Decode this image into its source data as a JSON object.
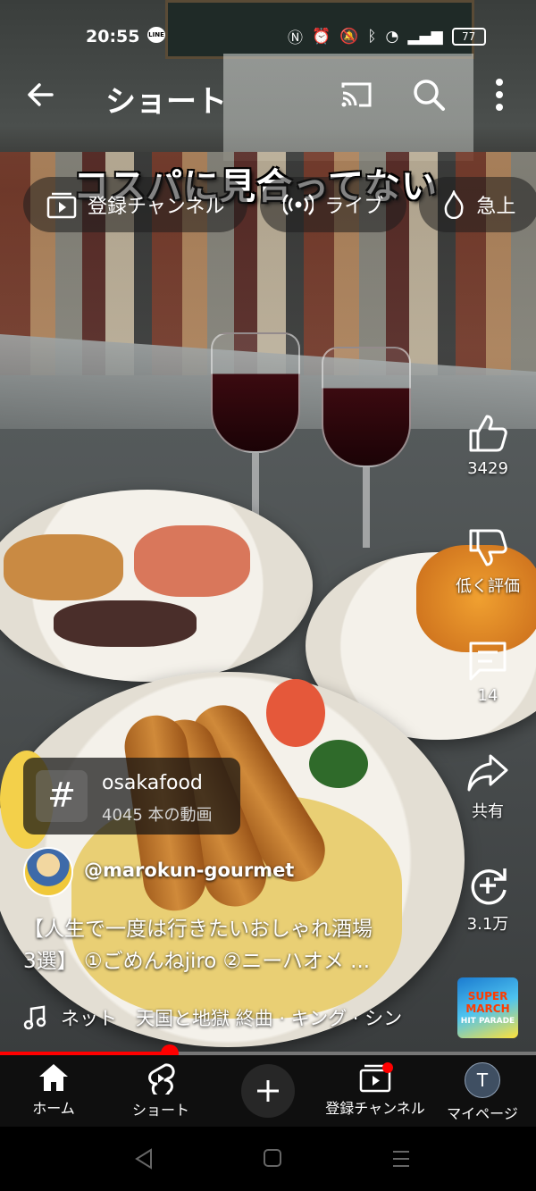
{
  "status_bar": {
    "time": "20:55",
    "line_badge": "LINE",
    "battery": "77"
  },
  "header": {
    "title": "ショート"
  },
  "video": {
    "caption": "コスパに見合ってない"
  },
  "chips": [
    {
      "label": "登録チャンネル",
      "icon": "subscriptions-icon"
    },
    {
      "label": "ライブ",
      "icon": "live-icon"
    },
    {
      "label": "急上",
      "icon": "trending-icon"
    }
  ],
  "actions": {
    "like_count": "3429",
    "dislike_label": "低く評価",
    "comment_count": "14",
    "share_label": "共有",
    "remix_count": "3.1万"
  },
  "hashtag": {
    "name": "osakafood",
    "count": "4045 本の動画"
  },
  "channel": {
    "handle": "@marokun-gourmet"
  },
  "description": {
    "line1": "【人生で一度は行きたいおしゃれ酒場",
    "line2": "3選】 ①ごめんねjiro ②ニーハオメ ..."
  },
  "music": {
    "text": "ネット　天国と地獄 終曲 · キング · シン"
  },
  "music_thumb": {
    "line1": "SUPER",
    "line2": "MARCH",
    "line3": "HIT PARADE"
  },
  "progress": {
    "fraction": 0.317
  },
  "bottom_nav": {
    "home": "ホーム",
    "shorts": "ショート",
    "subscriptions": "登録チャンネル",
    "you": "マイページ",
    "avatar_letter": "T"
  },
  "colors": {
    "accent": "#ff0000",
    "nav_bg": "#0f0f0f"
  }
}
